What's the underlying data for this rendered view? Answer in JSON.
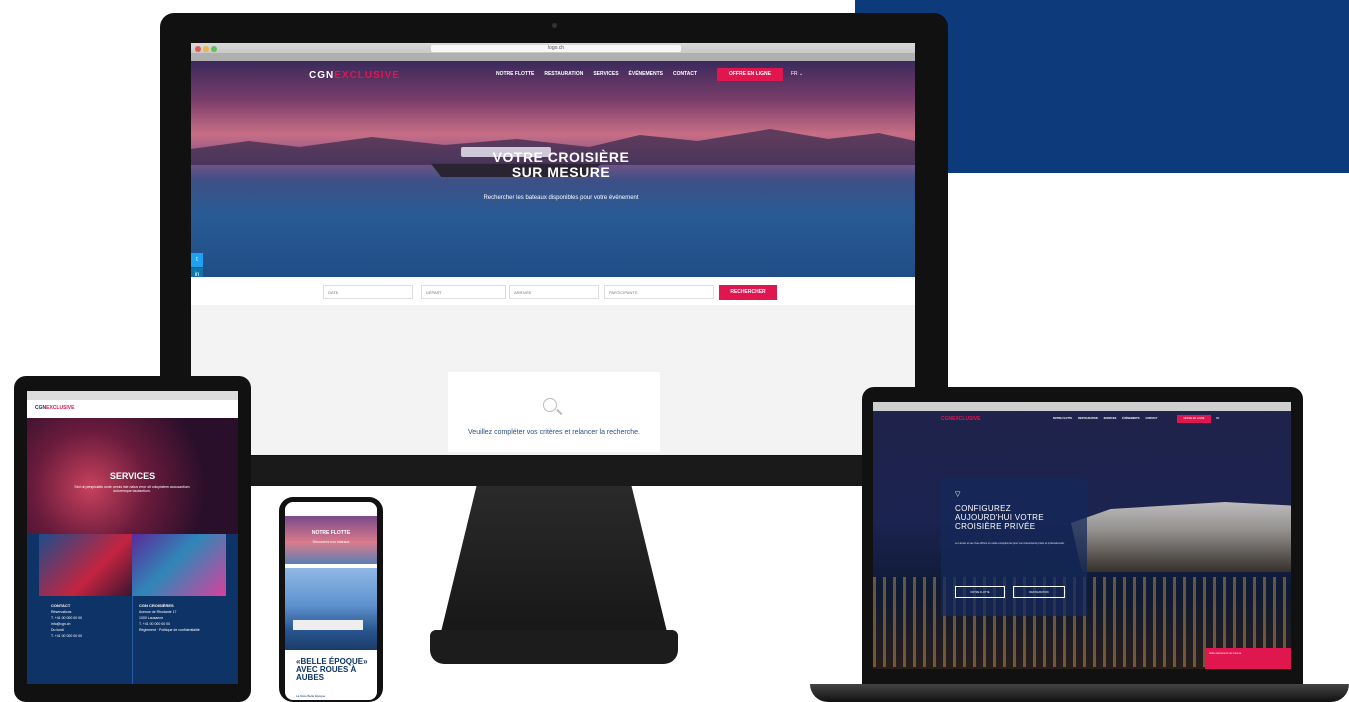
{
  "imac": {
    "browser_url": "logo.ch",
    "nav": {
      "logo_main": "CGN",
      "logo_accent": "EXCLUSIVE",
      "items": [
        "NOTRE FLOTTE",
        "RESTAURATION",
        "SERVICES",
        "ÉVÉNEMENTS",
        "CONTACT"
      ],
      "cta": "OFFRE EN LIGNE",
      "lang": "FR ⌄"
    },
    "hero": {
      "title_line1": "VOTRE CROISIÈRE",
      "title_line2": "SUR MESURE",
      "subtitle": "Rechercher les bateaux disponibles pour votre événement"
    },
    "social": [
      "t",
      "in",
      "f"
    ],
    "search": {
      "date": "DATE",
      "depart": "DÉPART",
      "arrivee": "ARRIVÉE",
      "participants": "PARTICIPANTS",
      "button": "RECHERCHER"
    },
    "empty_message": "Veuillez compléter vos critères et relancer la recherche."
  },
  "tablet": {
    "logo_main": "CGN",
    "logo_accent": "EXCLUSIVE",
    "title": "SERVICES",
    "description": "Sed ut perspiciatis unde omnis iste natus error sit voluptatem accusantium doloremque laudantium.",
    "col_left": {
      "heading": "CONTACT",
      "lines": [
        "Réservations",
        "T. +41 00 000 00 00",
        "info@cgn.ch",
        "Du lundi",
        "T. +41 00 000 00 00"
      ]
    },
    "col_right": {
      "heading": "CGN CROISIÈRES",
      "lines": [
        "Avenue de Rhodanie 17",
        "1000 Lausanne",
        "T. +41 00 000 00 00",
        "Règlement · Politique de confidentialité"
      ]
    }
  },
  "phone": {
    "hero_title": "NOTRE FLOTTE",
    "hero_sub": "Découvrez nos bateaux",
    "card_title": "«BELLE ÉPOQUE» AVEC ROUES À AUBES",
    "card_text": "La flotte Belle Époque"
  },
  "laptop": {
    "logo_main": "CGN",
    "logo_accent": "EXCLUSIVE",
    "nav": [
      "NOTRE FLOTTE",
      "RESTAURATION",
      "SERVICES",
      "ÉVÉNEMENTS",
      "CONTACT"
    ],
    "cta": "OFFRE EN LIGNE",
    "lang": "FR",
    "card": {
      "title_line1": "CONFIGUREZ",
      "title_line2": "AUJOURD'HUI VOTRE",
      "title_line3": "CROISIÈRE PRIVÉE",
      "text": "Le Léman et ses rives offrent un cadre exceptionnel pour vos événements privés et professionnels.",
      "btn_left": "NOTRE FLOTTE",
      "btn_right": "RESTAURATION"
    },
    "corner_text": "Votre événement sur mesure"
  },
  "colors": {
    "accent": "#e0174f",
    "navy": "#0e3366",
    "panel": "#0d3a7a"
  }
}
